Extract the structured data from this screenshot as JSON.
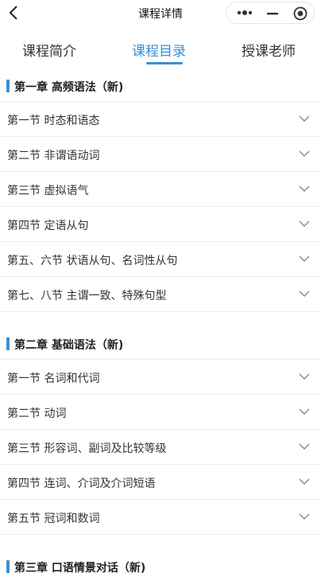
{
  "header": {
    "title": "课程详情"
  },
  "tabs": [
    {
      "label": "课程简介",
      "active": false
    },
    {
      "label": "课程目录",
      "active": true
    },
    {
      "label": "授课老师",
      "active": false
    }
  ],
  "colors": {
    "accent": "#3a8fd4",
    "divider": "#ececec"
  },
  "icons": {
    "back": "back-arrow-icon",
    "more": "more-dots-icon",
    "minimize": "minimize-icon",
    "close": "target-close-icon",
    "expand": "chevron-down-icon"
  },
  "chapters": [
    {
      "title": "第一章 高频语法（新)",
      "sections": [
        "第一节 时态和语态",
        "第二节 非谓语动词",
        "第三节 虚拟语气",
        "第四节 定语从句",
        "第五、六节 状语从句、名词性从句",
        "第七、八节 主谓一致、特殊句型"
      ]
    },
    {
      "title": "第二章 基础语法（新)",
      "sections": [
        "第一节 名词和代词",
        "第二节 动词",
        "第三节 形容词、副词及比较等级",
        "第四节 连词、介词及介词短语",
        "第五节 冠词和数词"
      ]
    },
    {
      "title": "第三章 口语情景对话（新)",
      "sections": []
    }
  ]
}
